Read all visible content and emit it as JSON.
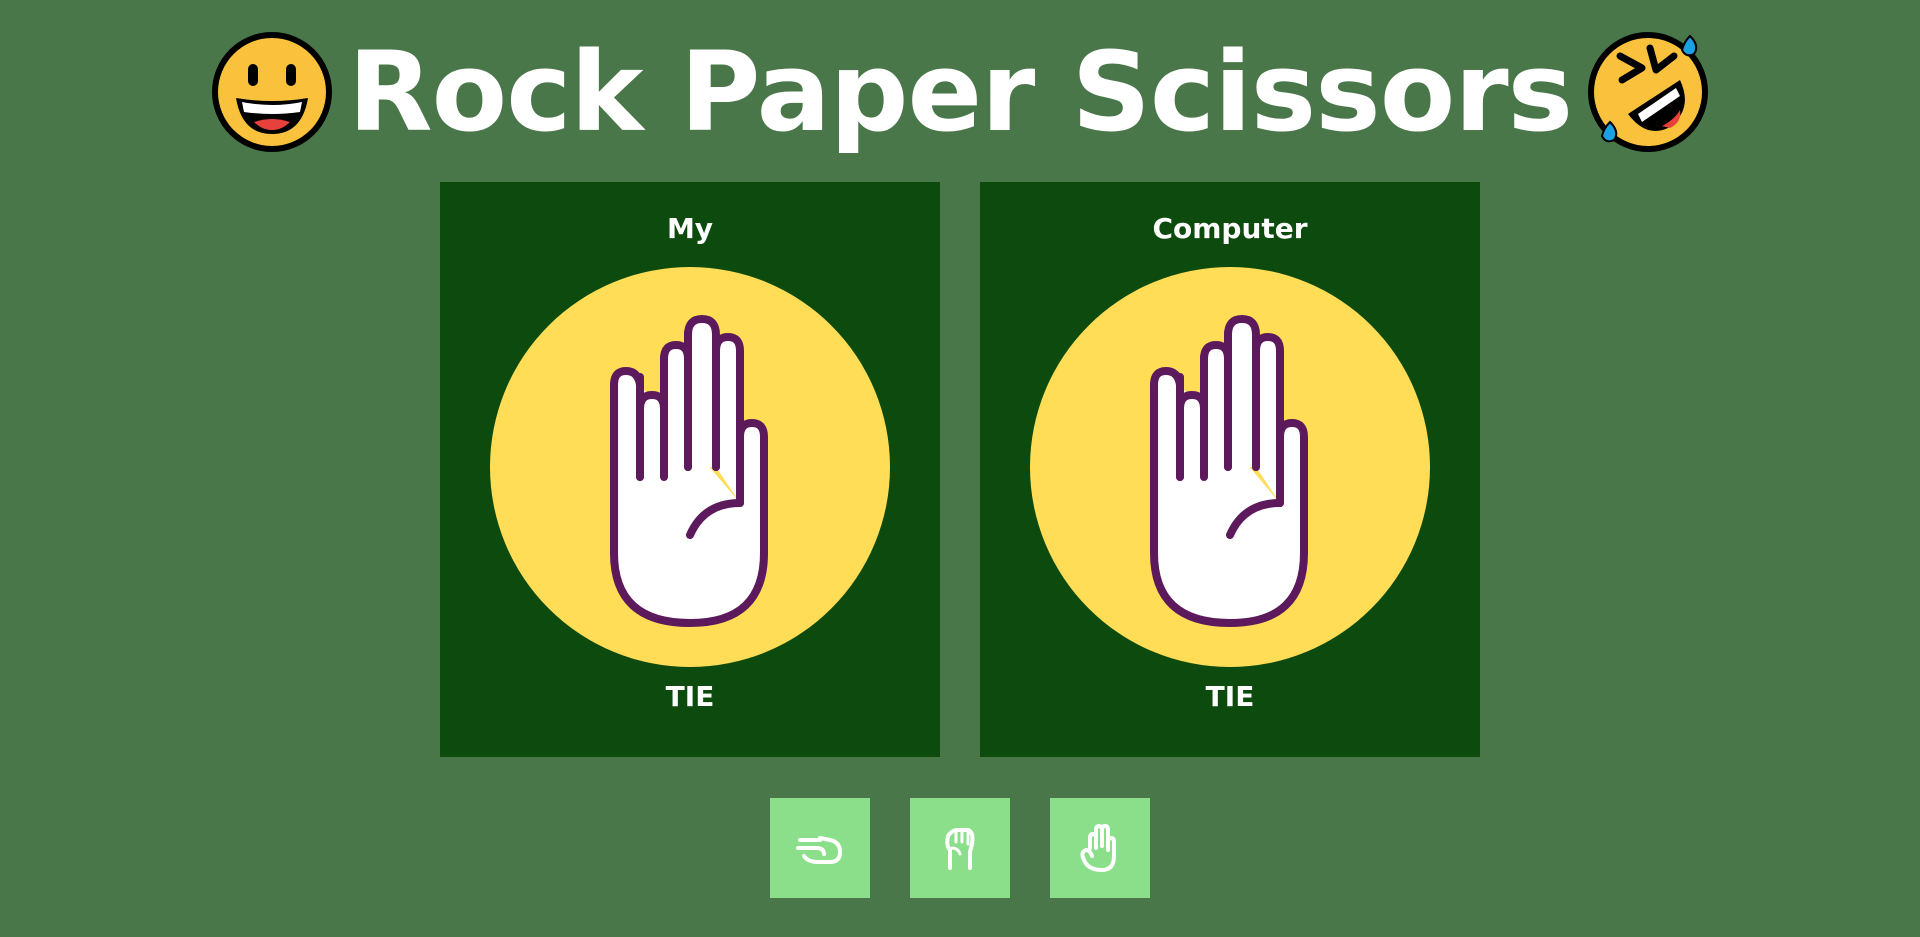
{
  "header": {
    "title": "Rock Paper Scissors",
    "left_emoji": "grinning-face-icon",
    "right_emoji": "rolling-on-floor-laughing-icon"
  },
  "players": [
    {
      "label": "My",
      "choice_icon": "paper-hand-icon",
      "result": "TIE"
    },
    {
      "label": "Computer",
      "choice_icon": "paper-hand-icon",
      "result": "TIE"
    }
  ],
  "choices": [
    {
      "name": "scissors",
      "icon": "scissors-hand-icon"
    },
    {
      "name": "rock",
      "icon": "rock-fist-icon"
    },
    {
      "name": "paper",
      "icon": "paper-hand-icon"
    }
  ],
  "colors": {
    "background": "#4a774a",
    "panel": "#0d4a0d",
    "circle": "#ffdd57",
    "hand_outline": "#5c1a5c",
    "button": "#8bdf8b"
  }
}
